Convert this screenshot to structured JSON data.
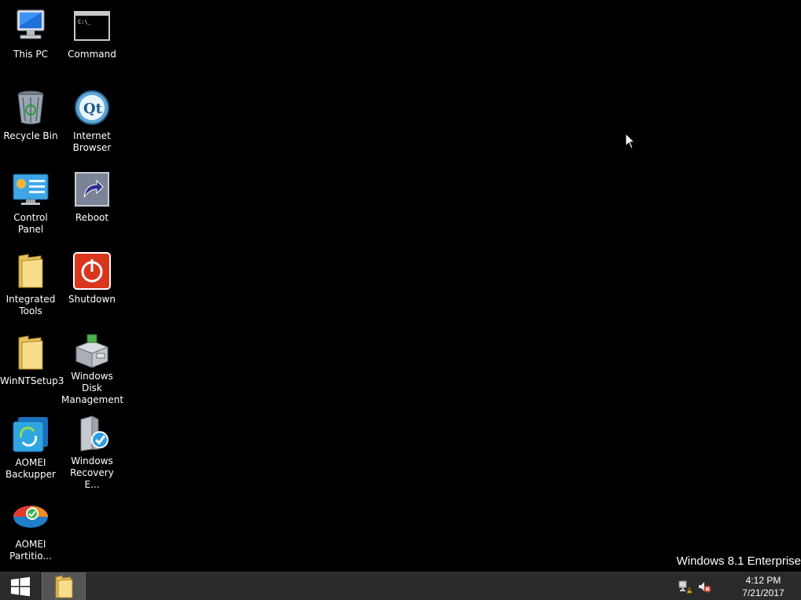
{
  "desktop": {
    "icons": {
      "this_pc": {
        "label": "This PC"
      },
      "command": {
        "label": "Command"
      },
      "recycle_bin": {
        "label": "Recycle Bin"
      },
      "internet_browser": {
        "label": "Internet\nBrowser"
      },
      "control_panel": {
        "label": "Control Panel"
      },
      "reboot": {
        "label": "Reboot"
      },
      "integrated_tools": {
        "label": "Integrated\nTools"
      },
      "shutdown": {
        "label": "Shutdown"
      },
      "winntsetup3": {
        "label": "WinNTSetup3"
      },
      "disk_management": {
        "label": "Windows Disk\nManagement"
      },
      "aomei_backupper": {
        "label": "AOMEI\nBackupper"
      },
      "windows_recovery": {
        "label": "Windows\nRecovery E..."
      },
      "aomei_partition": {
        "label": "AOMEI\nPartitio..."
      }
    },
    "watermark": "Windows 8.1 Enterprise"
  },
  "taskbar": {
    "clock": {
      "time": "4:12 PM",
      "date": "7/21/2017"
    },
    "tray_icons": [
      "network-warning-icon",
      "volume-muted-icon"
    ]
  },
  "colors": {
    "desktop_bg": "#000000",
    "taskbar_bg": "#2b2b2b",
    "folder_yellow": "#f4d27a",
    "shutdown_red": "#d9361e"
  }
}
